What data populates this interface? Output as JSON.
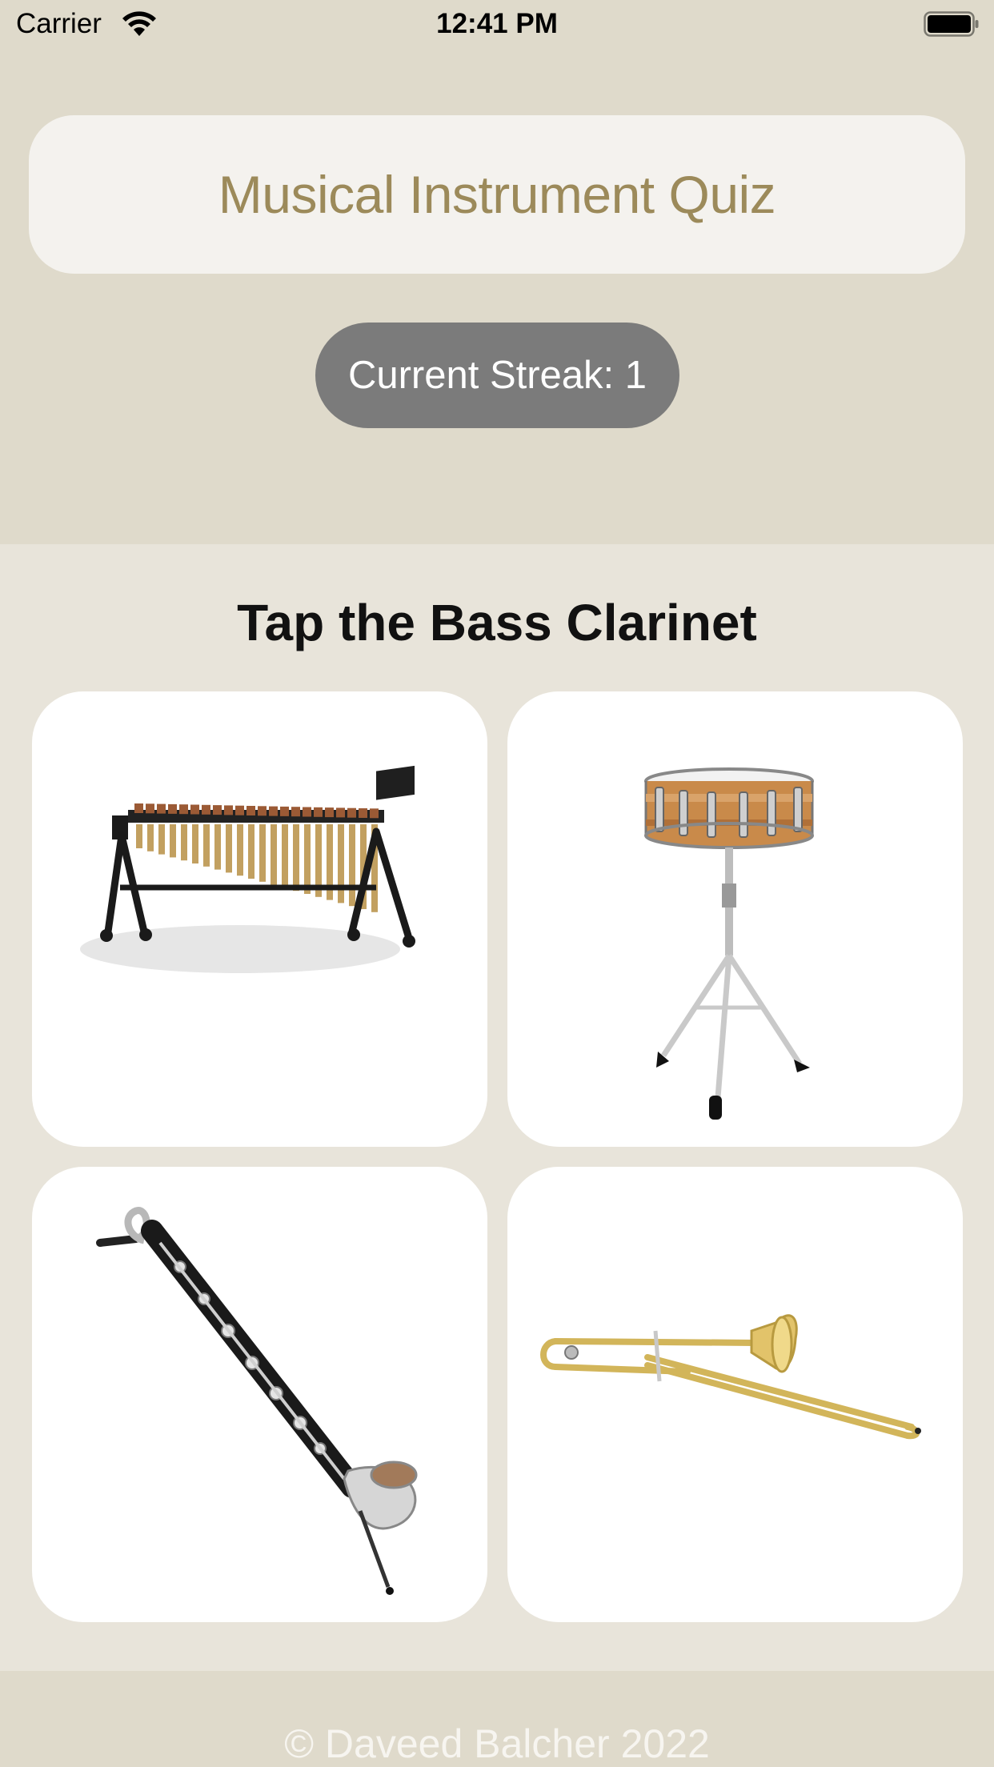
{
  "status_bar": {
    "carrier": "Carrier",
    "time": "12:41 PM",
    "wifi_icon": "wifi-icon",
    "battery_icon": "battery-full-icon"
  },
  "header": {
    "title": "Musical Instrument Quiz",
    "streak": "Current Streak: 1"
  },
  "quiz": {
    "prompt": "Tap the Bass Clarinet",
    "options": [
      {
        "instrument": "marimba"
      },
      {
        "instrument": "snare drum"
      },
      {
        "instrument": "bass clarinet"
      },
      {
        "instrument": "trombone"
      }
    ]
  },
  "footer": {
    "copyright": "© Daveed Balcher 2022"
  },
  "colors": {
    "header_background": "#dfdacb",
    "page_background": "#e8e4da",
    "title_card": "#f4f2ee",
    "title_text": "#9c8a5a",
    "streak_pill": "#7b7b7b",
    "tile": "#ffffff"
  }
}
